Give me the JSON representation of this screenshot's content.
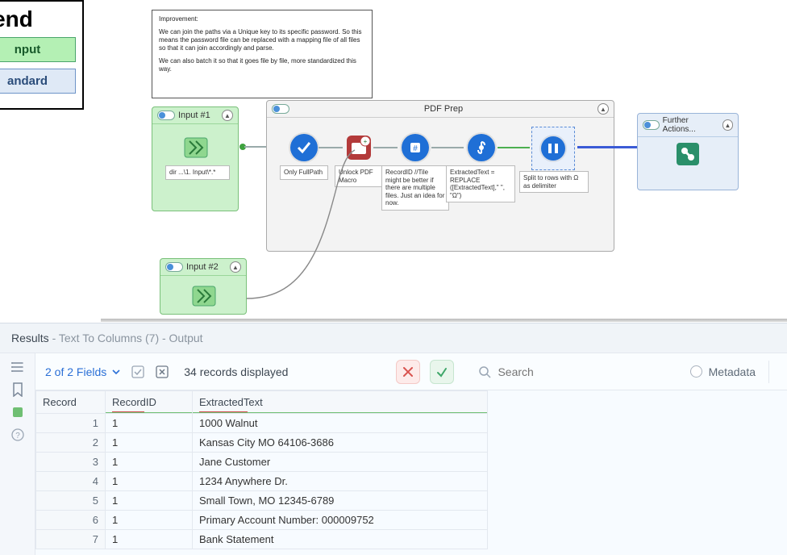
{
  "legend": {
    "title": "gend",
    "input_label": "nput",
    "standard_label": "andard"
  },
  "comment": {
    "heading": "Improvement:",
    "p1": "We can join the paths via a Unique key to its specific password. So this means the password file can be replaced with a mapping file of all files so that it can join accordingly and parse.",
    "p2": "We can also batch it so that it goes file by file, more standardized this way."
  },
  "containers": {
    "input1": {
      "title": "Input #1",
      "tool_label": "dir ...\\1. Input\\*.*"
    },
    "input2": {
      "title": "Input #2"
    },
    "pdfprep": {
      "title": "PDF Prep",
      "tools": {
        "select": "Only FullPath",
        "macro": "Unlock PDF Macro",
        "recordid": "RecordID\n\n//Tile might be better if there are multiple files. Just an idea for now.",
        "formula": "ExtractedText = REPLACE ([ExtractedText],\" \", \"Ω\")",
        "split": "Split to rows with Ω as delimiter"
      }
    },
    "further": {
      "title": "Further Actions..."
    }
  },
  "results": {
    "header_main": "Results",
    "header_sub": " - Text To Columns (7) - Output",
    "fields_label": "2 of 2 Fields",
    "records_label": "34 records displayed",
    "search_placeholder": "Search",
    "metadata_label": "Metadata",
    "columns": [
      "Record",
      "RecordID",
      "ExtractedText"
    ],
    "rows": [
      {
        "n": 1,
        "id": "1",
        "txt": "1000 Walnut"
      },
      {
        "n": 2,
        "id": "1",
        "txt": "Kansas City MO 64106-3686"
      },
      {
        "n": 3,
        "id": "1",
        "txt": "Jane Customer"
      },
      {
        "n": 4,
        "id": "1",
        "txt": "1234 Anywhere Dr."
      },
      {
        "n": 5,
        "id": "1",
        "txt": "Small Town, MO 12345-6789"
      },
      {
        "n": 6,
        "id": "1",
        "txt": "Primary Account Number: 000009752"
      },
      {
        "n": 7,
        "id": "1",
        "txt": "Bank Statement"
      }
    ]
  }
}
